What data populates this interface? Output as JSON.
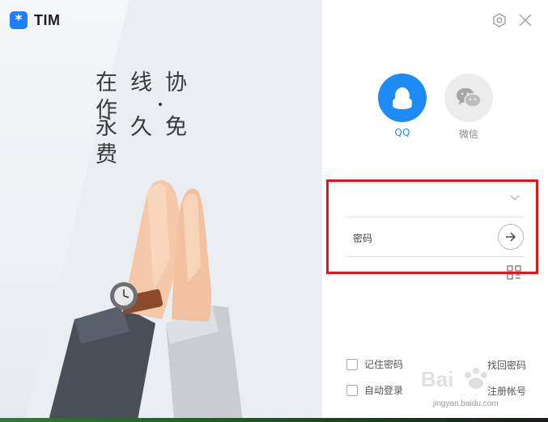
{
  "brand": {
    "name": "TIM",
    "logo_glyph": "*",
    "accent": "#1e7ffb"
  },
  "slogan": {
    "line1": "在线协作",
    "line2": "永久免费"
  },
  "window_controls": {
    "settings_icon": "settings-icon",
    "close_icon": "close-icon"
  },
  "login_tabs": [
    {
      "label": "QQ",
      "icon": "qq-penguin-icon",
      "selected": true,
      "color": "#1d8cf8"
    },
    {
      "label": "微信",
      "icon": "wechat-icon",
      "selected": false
    }
  ],
  "account": {
    "value": "",
    "placeholder": ""
  },
  "password": {
    "placeholder": "密码"
  },
  "options": {
    "remember_password": {
      "label": "记住密码",
      "checked": false
    },
    "auto_login": {
      "label": "自动登录",
      "checked": false
    }
  },
  "links": {
    "forgot_password": "找回密码",
    "register": "注册帐号"
  },
  "watermark": {
    "text": "jingyan.baidu.com"
  },
  "annotation": {
    "highlight_color": "#e0181e"
  }
}
